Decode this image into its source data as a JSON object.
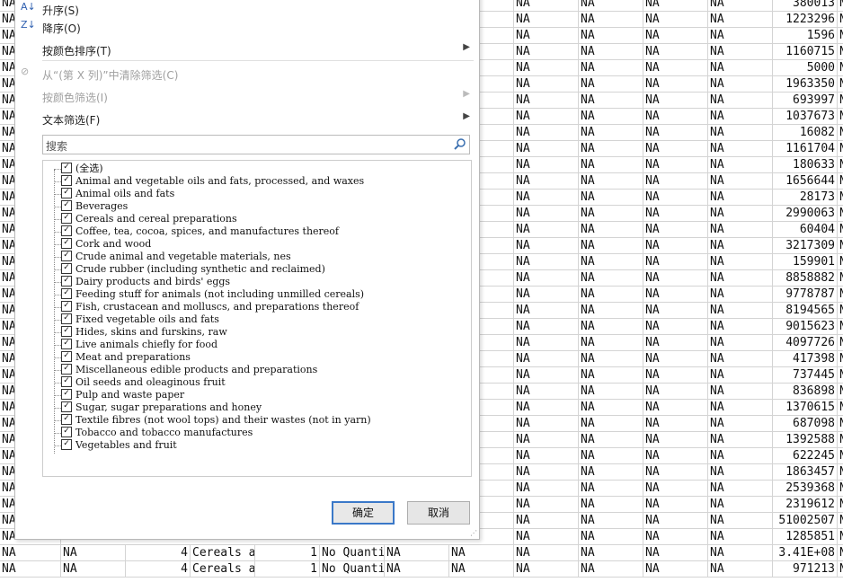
{
  "menu": {
    "sort_asc": "升序(S)",
    "sort_desc": "降序(O)",
    "sort_by_color": "按颜色排序(T)",
    "clear_filter": "从“(第 X 列)”中清除筛选(C)",
    "filter_by_color": "按颜色筛选(I)",
    "text_filter": "文本筛选(F)"
  },
  "search": {
    "placeholder": "搜索"
  },
  "filter_list": [
    "(全选)",
    "Animal and vegetable oils and fats, processed, and waxes",
    "Animal oils and fats",
    "Beverages",
    "Cereals and cereal preparations",
    "Coffee, tea, cocoa, spices, and manufactures thereof",
    "Cork and wood",
    "Crude animal and vegetable materials, nes",
    "Crude rubber (including synthetic and reclaimed)",
    "Dairy products and birds' eggs",
    "Feeding stuff for animals (not including unmilled cereals)",
    "Fish, crustacean and molluscs, and preparations thereof",
    "Fixed vegetable oils and fats",
    "Hides, skins and furskins, raw",
    "Live animals chiefly for food",
    "Meat and preparations",
    "Miscellaneous edible products and preparations",
    "Oil seeds and oleaginous fruit",
    "Pulp and waste paper",
    "Sugar, sugar preparations and honey",
    "Textile fibres (not wool tops) and their wastes (not in yarn)",
    "Tobacco and tobacco manufactures",
    "Vegetables and fruit"
  ],
  "buttons": {
    "ok": "确定",
    "cancel": "取消"
  },
  "sheet": {
    "na": "NA",
    "values": [
      "380013",
      "1223296",
      "1596",
      "1160715",
      "5000",
      "1963350",
      "693997",
      "1037673",
      "16082",
      "1161704",
      "180633",
      "1656644",
      "28173",
      "2990063",
      "60404",
      "3217309",
      "159901",
      "8858882",
      "9778787",
      "8194565",
      "9015623",
      "4097726",
      "417398",
      "737445",
      "836898",
      "1370615",
      "687098",
      "1392588",
      "622245",
      "1863457",
      "2539368",
      "2319612",
      "51002507",
      "1285851",
      "3.41E+08",
      "971213"
    ],
    "bottom_rows": [
      {
        "a": "NA",
        "b": "NA",
        "c": "4",
        "d": "Cereals a",
        "e": "1",
        "f": "No Quanti",
        "g": "NA",
        "h": "NA",
        "v": "3.41E+08"
      },
      {
        "a": "NA",
        "b": "NA",
        "c": "4",
        "d": "Cereals a",
        "e": "1",
        "f": "No Quanti",
        "g": "NA",
        "h": "NA",
        "v": "971213"
      }
    ]
  }
}
